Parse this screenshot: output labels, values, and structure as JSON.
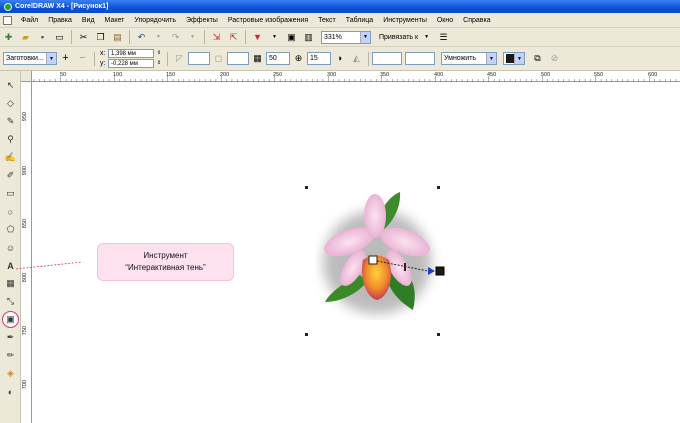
{
  "window": {
    "title": "CorelDRAW X4 - [Рисунок1]"
  },
  "menu": {
    "items": [
      "Файл",
      "Правка",
      "Вид",
      "Макет",
      "Упорядочить",
      "Эффекты",
      "Растровые изображения",
      "Текст",
      "Таблица",
      "Инструменты",
      "Окно",
      "Справка"
    ]
  },
  "toolbar1": {
    "zoom_value": "331%",
    "snap_label": "Привязать к"
  },
  "toolbar2": {
    "presets_value": "Заготовки...",
    "x_value": "1,398 мм",
    "y_value": "-0,228 мм",
    "x_label": "x:",
    "y_label": "y:",
    "opacity_value": "50",
    "feather_value": "15",
    "blend_mode_value": "Умножить",
    "shadow_color": "#1a1a1a"
  },
  "ruler": {
    "h_ticks": [
      "50",
      "100",
      "150",
      "200",
      "250",
      "300",
      "350",
      "400",
      "450",
      "500",
      "550",
      "600"
    ],
    "v_ticks": [
      "950",
      "900",
      "850",
      "800",
      "750",
      "700",
      "650"
    ]
  },
  "callout": {
    "line1": "Инструмент",
    "line2": "“Интерактивная тень”"
  },
  "colors": {
    "callout_bg": "#fde1ee",
    "callout_line": "#d03a6a",
    "shadow_arrow": "#1a3fd0"
  }
}
